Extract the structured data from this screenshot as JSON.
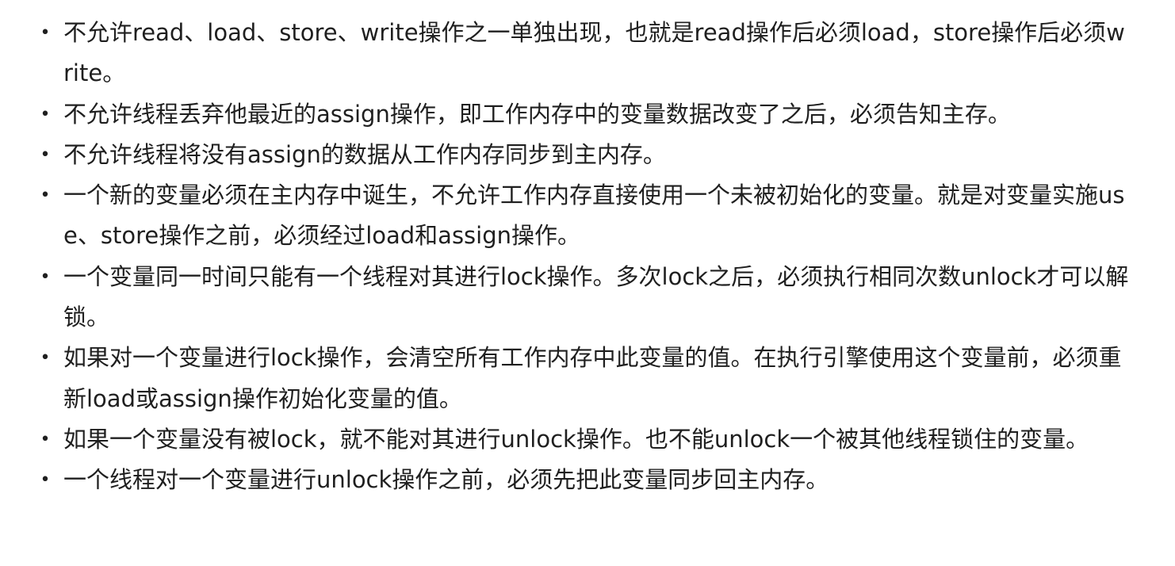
{
  "rules": [
    "不允许read、load、store、write操作之一单独出现，也就是read操作后必须load，store操作后必须write。",
    "不允许线程丢弃他最近的assign操作，即工作内存中的变量数据改变了之后，必须告知主存。",
    "不允许线程将没有assign的数据从工作内存同步到主内存。",
    "一个新的变量必须在主内存中诞生，不允许工作内存直接使用一个未被初始化的变量。就是对变量实施use、store操作之前，必须经过load和assign操作。",
    "一个变量同一时间只能有一个线程对其进行lock操作。多次lock之后，必须执行相同次数unlock才可以解锁。",
    "如果对一个变量进行lock操作，会清空所有工作内存中此变量的值。在执行引擎使用这个变量前，必须重新load或assign操作初始化变量的值。",
    "如果一个变量没有被lock，就不能对其进行unlock操作。也不能unlock一个被其他线程锁住的变量。",
    "一个线程对一个变量进行unlock操作之前，必须先把此变量同步回主内存。"
  ],
  "bullet_glyph": "•"
}
